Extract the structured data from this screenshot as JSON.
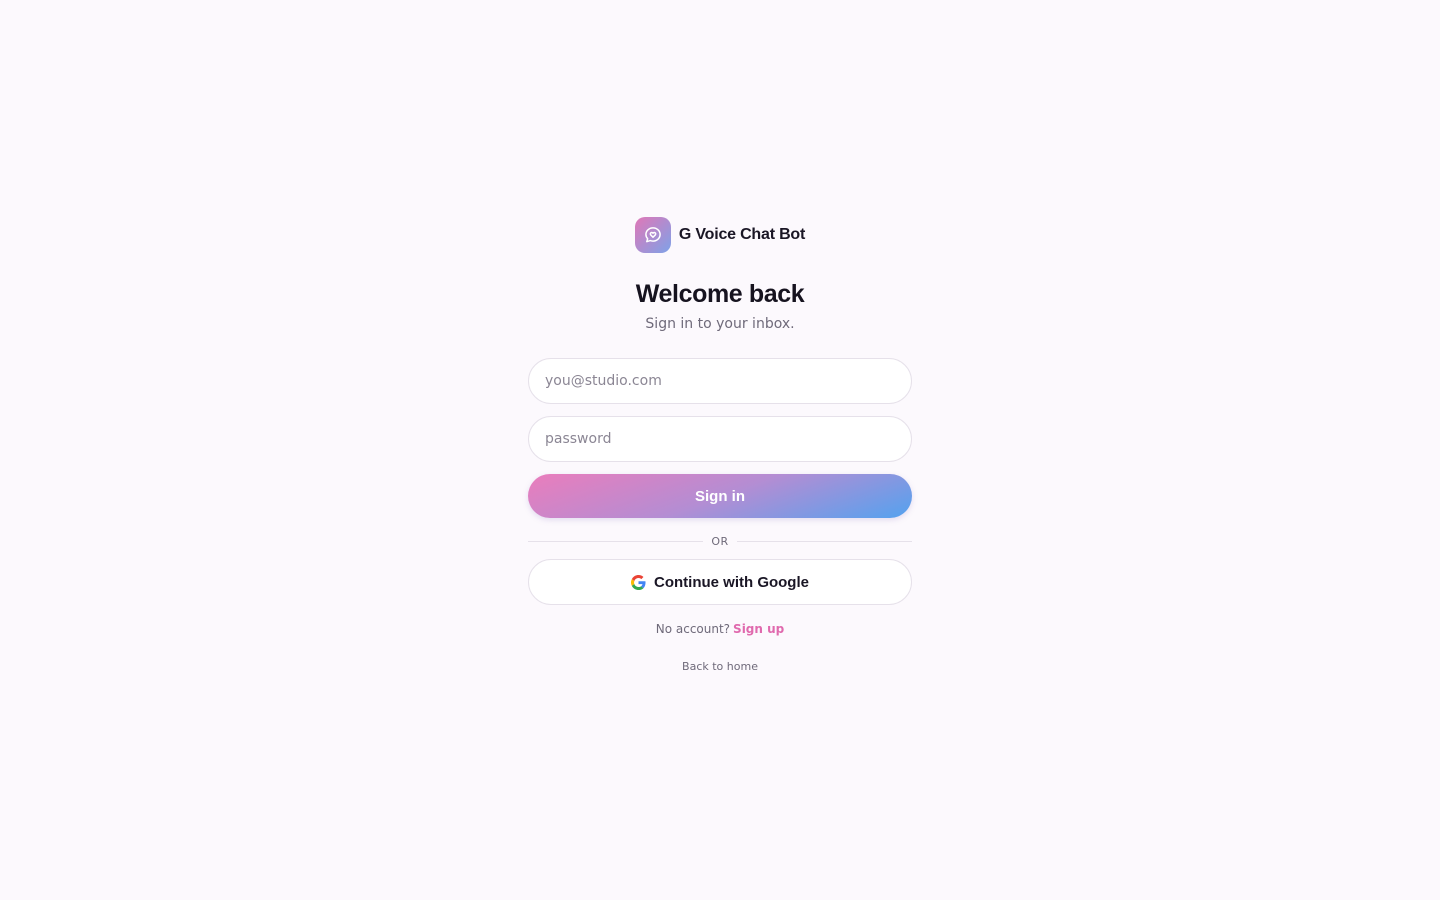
{
  "brand": {
    "name": "G Voice Chat Bot",
    "logo_icon": "heart-chat-bubble-icon"
  },
  "header": {
    "title": "Welcome back",
    "subtitle": "Sign in to your inbox."
  },
  "form": {
    "email_placeholder": "you@studio.com",
    "email_value": "",
    "password_placeholder": "password",
    "password_value": "",
    "signin_label": "Sign in",
    "divider_label": "OR",
    "google_label": "Continue with Google"
  },
  "footer": {
    "no_account_text": "No account?",
    "signup_label": "Sign up",
    "home_label": "Back to home"
  },
  "colors": {
    "background": "#fcf9fd",
    "accent_pink": "#e06aae",
    "gradient_start": "#ea7dbc",
    "gradient_end": "#54a2ef",
    "border": "#e6e1ea",
    "muted_text": "#6f6a7a"
  }
}
